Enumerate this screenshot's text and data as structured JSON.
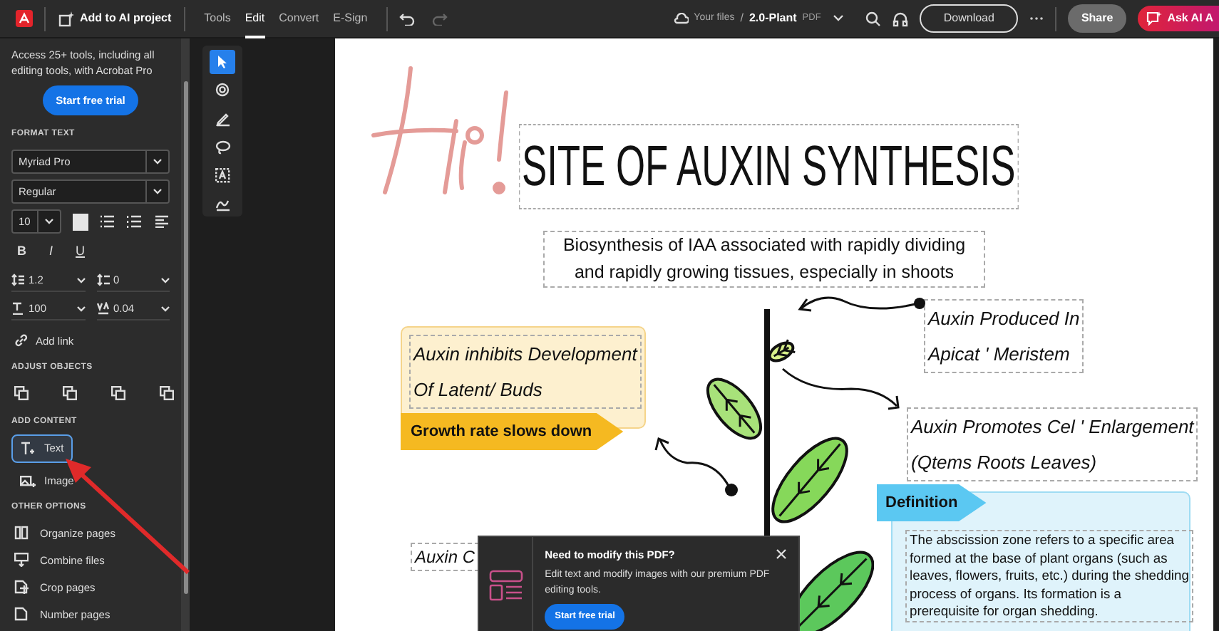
{
  "app_bar": {
    "add_to_ai_project": "Add to AI project",
    "menu": [
      {
        "label": "Tools",
        "selected": false
      },
      {
        "label": "Edit",
        "selected": true
      },
      {
        "label": "Convert",
        "selected": false
      },
      {
        "label": "E-Sign",
        "selected": false
      }
    ],
    "breadcrumb": {
      "location": "Your files",
      "separator": "/",
      "file_name": "2.0-Plant",
      "file_type": "PDF"
    },
    "download": "Download",
    "share": "Share",
    "ask_ai": "Ask AI A"
  },
  "sidebar": {
    "promo": "Access 25+ tools, including all editing tools, with Acrobat Pro",
    "promo_button": "Start free trial",
    "format_text": {
      "heading": "FORMAT TEXT",
      "font": "Myriad Pro",
      "style": "Regular",
      "size": "10",
      "bold": "B",
      "italic": "I",
      "underline": "U",
      "line_spacing": "1.2",
      "paragraph_spacing": "0",
      "horizontal_scale": "100",
      "character_spacing": "0.04"
    },
    "add_link": "Add link",
    "adjust_objects": {
      "heading": "ADJUST OBJECTS"
    },
    "add_content": {
      "heading": "ADD CONTENT",
      "items": [
        {
          "label": "Text",
          "kind": "text",
          "selected": true
        },
        {
          "label": "Image",
          "kind": "image",
          "selected": false
        }
      ]
    },
    "other_options": {
      "heading": "OTHER OPTIONS",
      "items": [
        {
          "label": "Organize pages",
          "kind": "organize"
        },
        {
          "label": "Combine files",
          "kind": "combine"
        },
        {
          "label": "Crop pages",
          "kind": "crop"
        },
        {
          "label": "Number pages",
          "kind": "number"
        }
      ]
    }
  },
  "tools": [
    {
      "kind": "select",
      "selected": true
    },
    {
      "kind": "comment",
      "selected": false
    },
    {
      "kind": "draw",
      "selected": false
    },
    {
      "kind": "lasso",
      "selected": false
    },
    {
      "kind": "textbox",
      "selected": false
    },
    {
      "kind": "sign",
      "selected": false
    }
  ],
  "document": {
    "title": "SITE OF AUXIN SYNTHESIS",
    "subtitle": "Biosynthesis of IAA associated with rapidly dividing and rapidly growing tissues, especially in shoots",
    "inhibits": [
      "Auxin inhibits Development",
      "Of Latent/ Buds"
    ],
    "growth_tag": "Growth rate slows down",
    "produced": [
      "Auxin Produced In",
      "Apicat ' Meristem"
    ],
    "promotes": [
      "Auxin Promotes Cel ' Enlargement",
      "(Qtems Roots Leaves)"
    ],
    "definition_tag": "Definition",
    "definition": "The abscission zone refers to a specific area formed at the base of plant organs (such as leaves, flowers, fruits, etc.) during the shedding process of organs. Its formation is a prerequisite for organ shedding.",
    "partial_label": "Auxin C"
  },
  "popup": {
    "title": "Need to modify this PDF?",
    "body": "Edit text and modify images with our premium PDF editing tools.",
    "button": "Start free trial"
  }
}
